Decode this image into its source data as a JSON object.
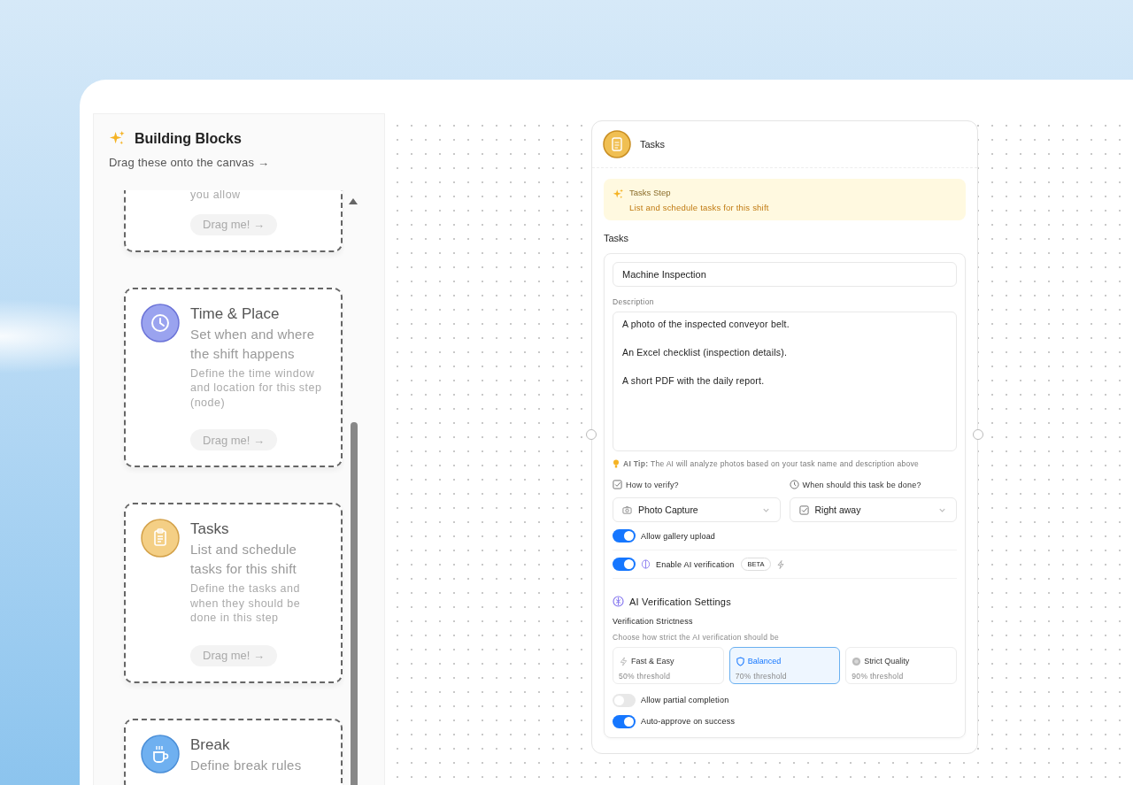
{
  "sidebar": {
    "title": "Building Blocks",
    "subtitle": "Drag these onto the canvas →",
    "blocks": [
      {
        "kind": "partial",
        "description": "you allow",
        "button": "Drag me! →"
      },
      {
        "kind": "clock",
        "title": "Time & Place",
        "subtitle": "Set when and where the shift happens",
        "description": "Define the time window and location for this step (node)",
        "button": "Drag me! →"
      },
      {
        "kind": "clipboard",
        "title": "Tasks",
        "subtitle": "List and schedule tasks for this shift",
        "description": "Define the tasks and when they should be done in this step",
        "button": "Drag me! →"
      },
      {
        "kind": "cup",
        "title": "Break",
        "subtitle": "Define break rules"
      }
    ]
  },
  "node": {
    "title": "Tasks",
    "banner": {
      "title": "Tasks Step",
      "text": "List and schedule tasks for this shift"
    },
    "section_label": "Tasks",
    "task": {
      "name": "Machine Inspection",
      "description_label": "Description",
      "description": "A photo of the inspected conveyor belt.\n\nAn Excel checklist (inspection details).\n\nA short PDF with the daily report.",
      "ai_tip": "**AI Tip:** The AI will analyze photos based on your task name and description above"
    },
    "verify": {
      "label": "How to verify?",
      "value": "Photo Capture"
    },
    "timing": {
      "label": "When should this task be done?",
      "value": "Right away"
    },
    "toggles_top": [
      {
        "label": "Allow gallery upload",
        "on": true
      },
      {
        "label": "Enable AI verification",
        "on": true,
        "badge": "BETA"
      }
    ],
    "ai_settings": {
      "title": "AI Verification Settings",
      "strictness_label": "Verification Strictness",
      "hint": "Choose how strict the AI verification should be",
      "options": [
        {
          "kind": "fast",
          "label": "Fast & Easy",
          "detail": "50% threshold",
          "selected": false
        },
        {
          "kind": "balanced",
          "label": "Balanced",
          "detail": "70% threshold",
          "selected": true
        },
        {
          "kind": "strict",
          "label": "Strict Quality",
          "detail": "90% threshold",
          "selected": false
        }
      ]
    },
    "toggles_bottom": [
      {
        "label": "Allow partial completion",
        "on": false
      },
      {
        "label": "Auto-approve on success",
        "on": true
      }
    ]
  }
}
